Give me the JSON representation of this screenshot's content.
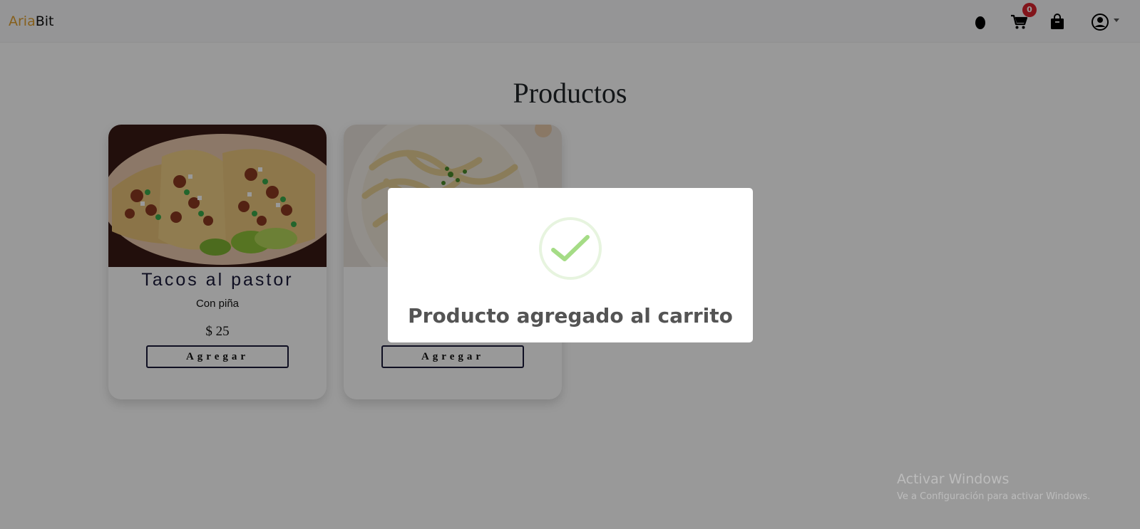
{
  "header": {
    "brand_part1": "Aria",
    "brand_part2": "Bit",
    "cart_count": "0",
    "icons": [
      "egg-icon",
      "cart-icon",
      "shopping-bag-icon",
      "user-circle-icon",
      "caret-down-icon"
    ]
  },
  "main": {
    "title": "Productos",
    "products": [
      {
        "name": "Tacos al pastor",
        "description": "Con piña",
        "price": "$ 25",
        "button": "Agregar"
      },
      {
        "name": "",
        "description": "",
        "price": "",
        "button": "Agregar"
      }
    ]
  },
  "modal": {
    "message": "Producto agregado al carrito",
    "icon": "check-success-icon"
  },
  "watermark": {
    "line1": "Activar Windows",
    "line2": "Ve a Configuración para activar Windows."
  },
  "colors": {
    "brand_accent": "#e0a030",
    "badge": "#d9232e",
    "success": "#a5dc86",
    "card_border": "#1a1a3a"
  }
}
